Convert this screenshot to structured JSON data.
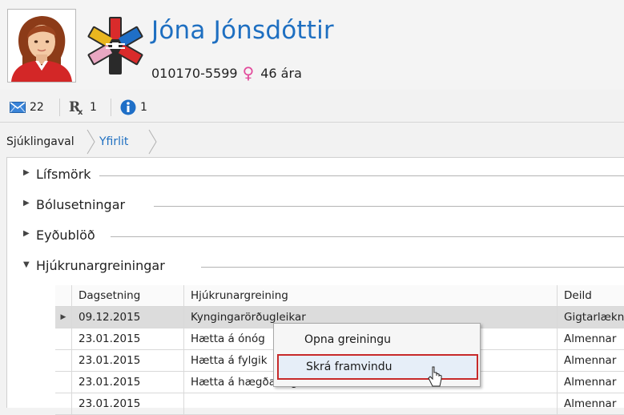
{
  "patient": {
    "name": "Jóna Jónsdóttir",
    "id": "010170-5599",
    "gender_symbol": "♀",
    "age": "46 ára"
  },
  "icon_bar": {
    "messages_count": "22",
    "prescriptions_count": "1",
    "info_count": "1",
    "prescription_label": "Rx"
  },
  "breadcrumb": [
    {
      "label": "Sjúklingaval"
    },
    {
      "label": "Yfirlit"
    }
  ],
  "sections": [
    {
      "title": "Lífsmörk",
      "expanded": false
    },
    {
      "title": "Bólusetningar",
      "expanded": false
    },
    {
      "title": "Eyðublöð",
      "expanded": false
    },
    {
      "title": "Hjúkrunargreiningar",
      "expanded": true
    }
  ],
  "grid": {
    "columns": [
      "Dagsetning",
      "Hjúkrunargreining",
      "Deild"
    ],
    "rows": [
      {
        "date": "09.12.2015",
        "diagnosis": "Kyngingarörðugleikar",
        "department": "Gigtarlækn",
        "selected": true
      },
      {
        "date": "23.01.2015",
        "diagnosis": "Hætta á ónóg",
        "department": "Almennar"
      },
      {
        "date": "23.01.2015",
        "diagnosis": "Hætta á fylgik",
        "department": "Almennar"
      },
      {
        "date": "23.01.2015",
        "diagnosis": "Hætta á hægðatregðu",
        "department": "Almennar"
      },
      {
        "date": "23.01.2015",
        "diagnosis": "",
        "department": "Almennar"
      }
    ]
  },
  "context_menu": {
    "items": [
      {
        "label": "Opna greiningu"
      },
      {
        "label": "Skrá framvindu",
        "highlighted": true
      }
    ]
  },
  "colors": {
    "accent": "#1e6fc1",
    "female": "#e24a9b",
    "highlight_border": "#c72a2a",
    "breadcrumb_active": "#1e6fc1"
  },
  "icons": [
    "avatar",
    "medical-logo-icon",
    "mail-icon",
    "rx-icon",
    "info-icon",
    "female-icon",
    "chevron-right-icon",
    "expand-arrow-icon",
    "row-indicator-icon",
    "mouse-cursor-icon"
  ]
}
